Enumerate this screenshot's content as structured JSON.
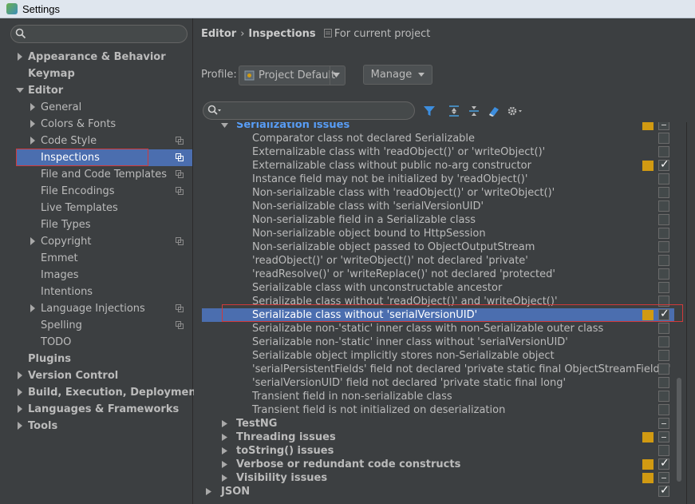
{
  "window": {
    "title": "Settings"
  },
  "sidebar": {
    "search_placeholder": "",
    "items": [
      {
        "label": "Appearance & Behavior",
        "level": 0,
        "bold": true,
        "expandable": true,
        "expanded": false,
        "copy": false
      },
      {
        "label": "Keymap",
        "level": 0,
        "bold": true,
        "expandable": false,
        "copy": false
      },
      {
        "label": "Editor",
        "level": 0,
        "bold": true,
        "expandable": true,
        "expanded": true,
        "copy": false
      },
      {
        "label": "General",
        "level": 1,
        "bold": false,
        "expandable": true,
        "expanded": false,
        "copy": false
      },
      {
        "label": "Colors & Fonts",
        "level": 1,
        "bold": false,
        "expandable": true,
        "expanded": false,
        "copy": false
      },
      {
        "label": "Code Style",
        "level": 1,
        "bold": false,
        "expandable": true,
        "expanded": false,
        "copy": true
      },
      {
        "label": "Inspections",
        "level": 1,
        "bold": false,
        "expandable": false,
        "selected": true,
        "copy": true
      },
      {
        "label": "File and Code Templates",
        "level": 1,
        "bold": false,
        "expandable": false,
        "copy": true
      },
      {
        "label": "File Encodings",
        "level": 1,
        "bold": false,
        "expandable": false,
        "copy": true
      },
      {
        "label": "Live Templates",
        "level": 1,
        "bold": false,
        "expandable": false,
        "copy": false
      },
      {
        "label": "File Types",
        "level": 1,
        "bold": false,
        "expandable": false,
        "copy": false
      },
      {
        "label": "Copyright",
        "level": 1,
        "bold": false,
        "expandable": true,
        "expanded": false,
        "copy": true
      },
      {
        "label": "Emmet",
        "level": 1,
        "bold": false,
        "expandable": false,
        "copy": false
      },
      {
        "label": "Images",
        "level": 1,
        "bold": false,
        "expandable": false,
        "copy": false
      },
      {
        "label": "Intentions",
        "level": 1,
        "bold": false,
        "expandable": false,
        "copy": false
      },
      {
        "label": "Language Injections",
        "level": 1,
        "bold": false,
        "expandable": true,
        "expanded": false,
        "copy": true
      },
      {
        "label": "Spelling",
        "level": 1,
        "bold": false,
        "expandable": false,
        "copy": true
      },
      {
        "label": "TODO",
        "level": 1,
        "bold": false,
        "expandable": false,
        "copy": false
      },
      {
        "label": "Plugins",
        "level": 0,
        "bold": true,
        "expandable": false,
        "copy": false
      },
      {
        "label": "Version Control",
        "level": 0,
        "bold": true,
        "expandable": true,
        "expanded": false,
        "copy": false
      },
      {
        "label": "Build, Execution, Deployment",
        "level": 0,
        "bold": true,
        "expandable": true,
        "expanded": false,
        "copy": false
      },
      {
        "label": "Languages & Frameworks",
        "level": 0,
        "bold": true,
        "expandable": true,
        "expanded": false,
        "copy": false
      },
      {
        "label": "Tools",
        "level": 0,
        "bold": true,
        "expandable": true,
        "expanded": false,
        "copy": false
      }
    ]
  },
  "header": {
    "breadcrumb_parent": "Editor",
    "breadcrumb_sep": "›",
    "breadcrumb_current": "Inspections",
    "scope_note": "For current project"
  },
  "profile": {
    "label": "Profile:",
    "value": "Project Default",
    "manage_label": "Manage"
  },
  "filter": {
    "placeholder": ""
  },
  "inspections": [
    {
      "text": "Serialization issues",
      "group": true,
      "expanded": true,
      "severity": true,
      "check": "mixed"
    },
    {
      "text": "Comparator class not declared Serializable",
      "group": false,
      "severity": false,
      "check": "none"
    },
    {
      "text": "Externalizable class with 'readObject()' or 'writeObject()'",
      "group": false,
      "severity": false,
      "check": "none"
    },
    {
      "text": "Externalizable class without public no-arg constructor",
      "group": false,
      "severity": true,
      "check": "checked"
    },
    {
      "text": "Instance field may not be initialized by 'readObject()'",
      "group": false,
      "severity": false,
      "check": "none"
    },
    {
      "text": "Non-serializable class with 'readObject()' or 'writeObject()'",
      "group": false,
      "severity": false,
      "check": "none"
    },
    {
      "text": "Non-serializable class with 'serialVersionUID'",
      "group": false,
      "severity": false,
      "check": "none"
    },
    {
      "text": "Non-serializable field in a Serializable class",
      "group": false,
      "severity": false,
      "check": "none"
    },
    {
      "text": "Non-serializable object bound to HttpSession",
      "group": false,
      "severity": false,
      "check": "none"
    },
    {
      "text": "Non-serializable object passed to ObjectOutputStream",
      "group": false,
      "severity": false,
      "check": "none"
    },
    {
      "text": "'readObject()' or 'writeObject()' not declared 'private'",
      "group": false,
      "severity": false,
      "check": "none"
    },
    {
      "text": "'readResolve()' or 'writeReplace()' not declared 'protected'",
      "group": false,
      "severity": false,
      "check": "none"
    },
    {
      "text": "Serializable class with unconstructable ancestor",
      "group": false,
      "severity": false,
      "check": "none"
    },
    {
      "text": "Serializable class without 'readObject()' and 'writeObject()'",
      "group": false,
      "severity": false,
      "check": "none"
    },
    {
      "text": "Serializable class without 'serialVersionUID'",
      "group": false,
      "severity": true,
      "check": "checked",
      "selected": true
    },
    {
      "text": "Serializable non-'static' inner class with non-Serializable outer class",
      "group": false,
      "severity": false,
      "check": "none"
    },
    {
      "text": "Serializable non-'static' inner class without 'serialVersionUID'",
      "group": false,
      "severity": false,
      "check": "none"
    },
    {
      "text": "Serializable object implicitly stores non-Serializable object",
      "group": false,
      "severity": false,
      "check": "none"
    },
    {
      "text": "'serialPersistentFields' field not declared 'private static final ObjectStreamField[]'",
      "group": false,
      "severity": false,
      "check": "none"
    },
    {
      "text": "'serialVersionUID' field not declared 'private static final long'",
      "group": false,
      "severity": false,
      "check": "none"
    },
    {
      "text": "Transient field in non-serializable class",
      "group": false,
      "severity": false,
      "check": "none"
    },
    {
      "text": "Transient field is not initialized on deserialization",
      "group": false,
      "severity": false,
      "check": "none"
    },
    {
      "text": "TestNG",
      "group": true,
      "expanded": false,
      "severity": false,
      "check": "mixed"
    },
    {
      "text": "Threading issues",
      "group": true,
      "expanded": false,
      "severity": true,
      "check": "mixed"
    },
    {
      "text": "toString() issues",
      "group": true,
      "expanded": false,
      "severity": false,
      "check": "none"
    },
    {
      "text": "Verbose or redundant code constructs",
      "group": true,
      "expanded": false,
      "severity": true,
      "check": "checked"
    },
    {
      "text": "Visibility issues",
      "group": true,
      "expanded": false,
      "severity": true,
      "check": "mixed"
    },
    {
      "text": "JSON",
      "group": true,
      "expanded": false,
      "severity": false,
      "check": "checked",
      "top_level": true
    }
  ],
  "colors": {
    "selection": "#4b6eaf",
    "warning": "#d19a12",
    "highlight_outline": "#d13a3a"
  }
}
